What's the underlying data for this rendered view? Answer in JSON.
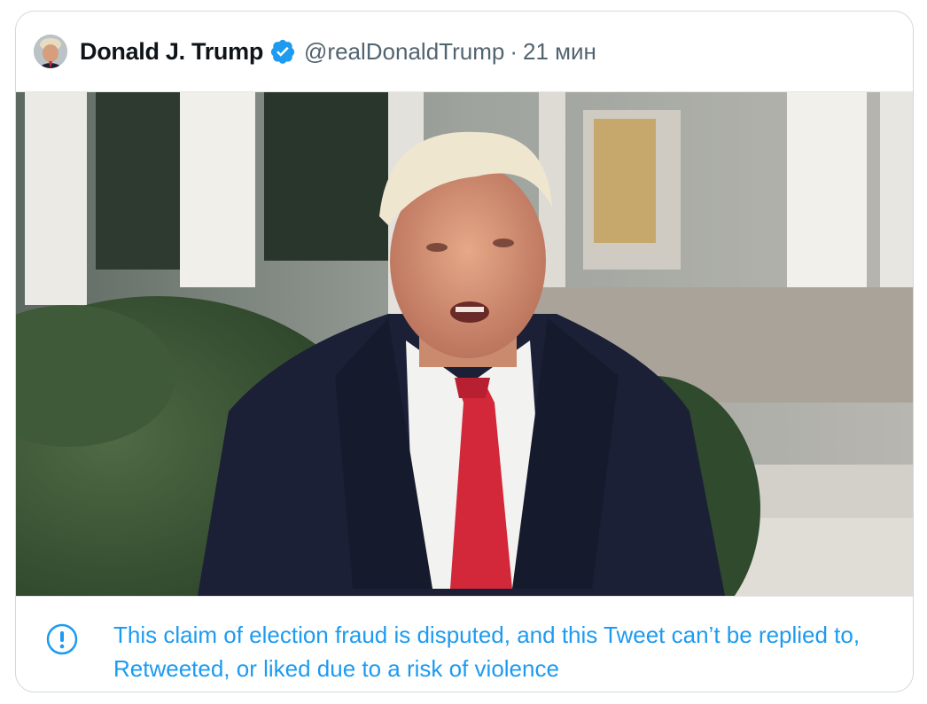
{
  "tweet": {
    "author_name": "Donald J. Trump",
    "handle": "@realDonaldTrump",
    "separator": "·",
    "time": "21 мин",
    "verified_icon": "verified-badge-icon",
    "media": {
      "type": "video-still",
      "description_icon": "media-image"
    },
    "notice": {
      "icon": "exclamation-circle-icon",
      "text": "This claim of election fraud is disputed, and this Tweet can’t be replied to, Retweeted, or liked due to a risk of violence"
    }
  },
  "colors": {
    "notice_blue": "#1d9bf0",
    "handle_gray": "#536471",
    "border": "#cfd9de",
    "name_black": "#0f1419"
  }
}
